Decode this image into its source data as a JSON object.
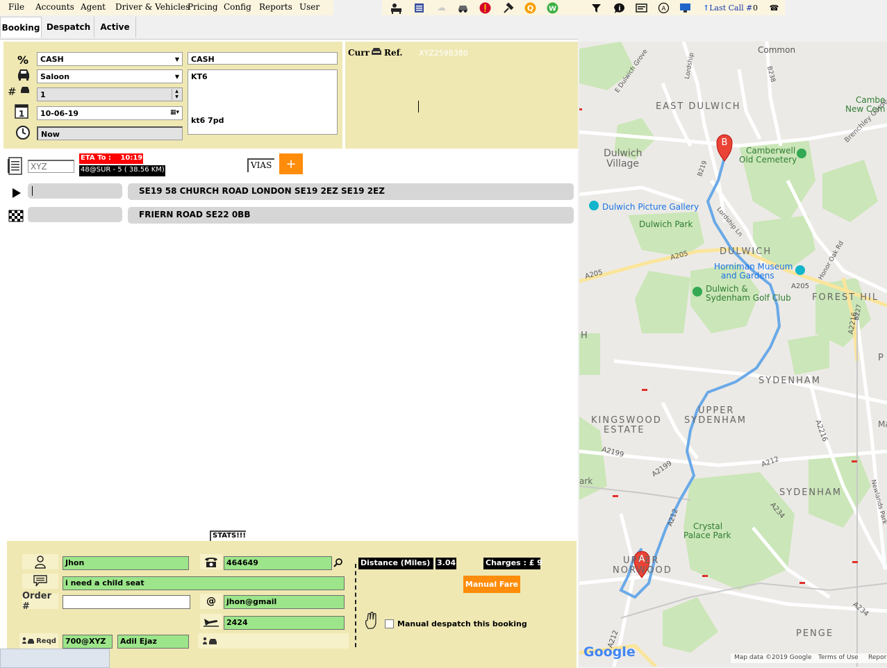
{
  "menu": [
    "File",
    "Accounts",
    "Agent",
    "Driver & Vehicles",
    "Pricing",
    "Config",
    "Reports",
    "User"
  ],
  "toolbar": {
    "icons": [
      "driver-icon",
      "list-icon",
      "cloud-icon",
      "car-icon",
      "alert-icon",
      "pin-icon",
      "q-icon",
      "w-icon",
      "filter-icon",
      "chat-icon",
      "message-icon",
      "at-icon",
      "monitor-icon"
    ],
    "last_call_label": "Last Call #",
    "last_call_value": "0",
    "extra_value": "0"
  },
  "tabs": [
    "Booking",
    "Despatch",
    "Active"
  ],
  "booking": {
    "payment_type": "CASH",
    "payment_text": "CASH",
    "vehicle_type": "Saloon",
    "passengers": "1",
    "date": "10-06-19",
    "time": "Now",
    "address_note_1": "KT6",
    "address_note_2": "kt6 7pd"
  },
  "ref": {
    "label": "Curr",
    "ref_label": "Ref.",
    "ref_value": "XYZ2598380"
  },
  "account": {
    "code_placeholder": "XYZ",
    "eta_label": "ETA To :",
    "eta_value": "10:19",
    "route_info": "48@SUR - 5 ( 38.56 KM)",
    "vias_label": "VIAS",
    "add_label": "+"
  },
  "pickup_address": "SE19 58 CHURCH ROAD LONDON SE19 2EZ SE19 2EZ",
  "dropoff_address": "FRIERN ROAD SE22 0BB",
  "stats_label": "STATS!!!",
  "customer": {
    "name": "Jhon",
    "phone": "464649",
    "notes": "i need a child seat",
    "order_label": "Order #",
    "order_value": "",
    "email": "jhon@gmail",
    "flight": "2424",
    "reqd_label": "Reqd",
    "driver_code": "700@XYZ",
    "driver_name": "Adil Ejaz"
  },
  "fare": {
    "distance_label": "Distance (Miles) :",
    "distance_value": "3.04",
    "charges_label": "Charges : £ 9",
    "manual_fare_label": "Manual Fare",
    "manual_despatch_label": "Manual despatch this booking"
  },
  "map": {
    "labels": {
      "common": "Common",
      "east_dulwich": "EAST DULWICH",
      "dulwich_village_1": "Dulwich",
      "dulwich_village_2": "Village",
      "camberwell_1": "Camberwell",
      "camberwell_2": "Old Cemetery",
      "cambe_1": "Cambe",
      "cambe_2": "New Cem",
      "brenchley": "Brenchley Garde",
      "picture_gallery": "Dulwich Picture Gallery",
      "dulwich_park": "Dulwich Park",
      "dulwich": "DULWICH",
      "horniman_1": "Horniman Museum",
      "horniman_2": "and Gardens",
      "golf_1": "Dulwich &",
      "golf_2": "Sydenham Golf Club",
      "forest_hill": "FOREST HIL",
      "sydenham_1": "SYDENHAM",
      "upper_1": "UPPER",
      "upper_2": "SYDENHAM",
      "kingswood_1": "KINGSWOOD",
      "kingswood_2": "ESTATE",
      "sydenham_2": "SYDENHAM",
      "crystal_1": "Crystal",
      "crystal_2": "Palace Park",
      "norwood_1": "UPPER",
      "norwood_2": "NORWOOD",
      "penge": "PENGE",
      "ark": "ark",
      "h": "H",
      "p": "P",
      "ma": "Ma",
      "a205_1": "A205",
      "a205_2": "A205",
      "a205_3": "A205",
      "a2199_1": "A2199",
      "a2199_2": "A2199",
      "a212_1": "A212",
      "a212_2": "A212",
      "a212_3": "A212",
      "a234_1": "A234",
      "a234_2": "A234",
      "a2216_1": "A2216",
      "a2216_2": "A2216",
      "b238": "B238",
      "b219": "B219",
      "b227": "B227",
      "lordship_1": "Lordship",
      "lordship_2": "Lordship Ln",
      "honor_oak": "Honor Oak Rd",
      "newlands": "Newlands Park",
      "grove": "E Dulwich Grove",
      "marker_a": "A",
      "marker_b": "B",
      "google": "Google",
      "map_data": "Map data ©2019 Google",
      "terms": "Terms of Use",
      "report": "Repor"
    }
  }
}
